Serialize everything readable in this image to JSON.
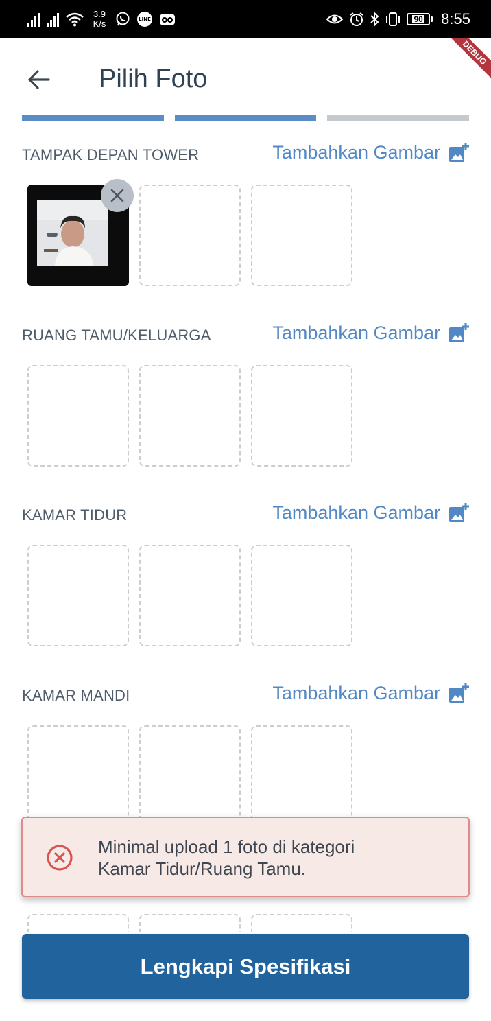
{
  "status_bar": {
    "network_speed_value": "3.9",
    "network_speed_unit": "K/s",
    "battery": "90",
    "time": "8:55",
    "icons": [
      "signal-icon",
      "signal-icon",
      "wifi-icon",
      "whatsapp-icon",
      "line-icon",
      "tripadvisor-icon",
      "eye-icon",
      "alarm-icon",
      "bluetooth-icon",
      "vibrate-icon",
      "battery-icon"
    ]
  },
  "debug_banner": "DEBUG",
  "header": {
    "title": "Pilih Foto",
    "back_icon": "arrow-back-icon"
  },
  "progress": {
    "steps_total": 3,
    "steps_done": 2,
    "done_color": "#5b8cc5",
    "todo_color": "#c4c9ce"
  },
  "add_image_label": "Tambahkan Gambar",
  "sections": [
    {
      "title": "TAMPAK DEPAN TOWER",
      "has_photo": true
    },
    {
      "title": "RUANG TAMU/KELUARGA",
      "has_photo": false
    },
    {
      "title": "KAMAR TIDUR",
      "has_photo": false
    },
    {
      "title": "KAMAR MANDI",
      "has_photo": false
    }
  ],
  "toast": {
    "line1": "Minimal upload 1 foto di kategori",
    "line2": "Kamar Tidur/Ruang Tamu.",
    "icon": "error-circle-icon",
    "border_color": "#e08b8b",
    "background": "#f6e9e6"
  },
  "primary_button": {
    "label": "Lengkapi Spesifikasi",
    "color": "#20639d"
  }
}
